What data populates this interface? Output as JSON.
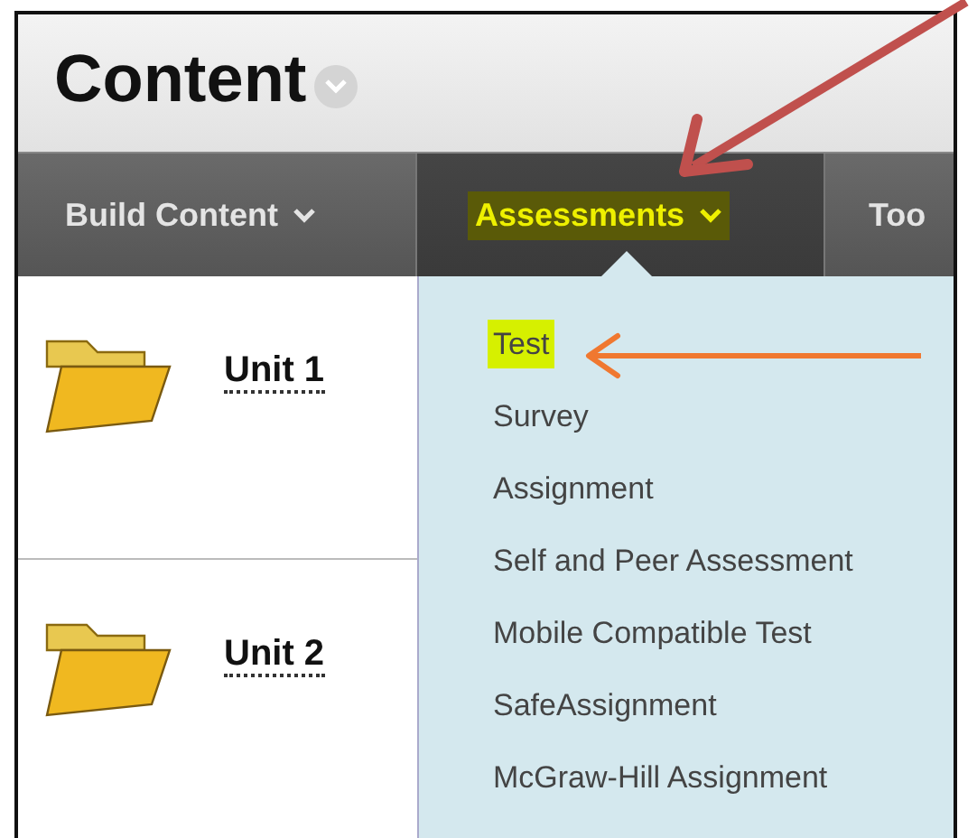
{
  "page": {
    "title": "Content"
  },
  "tabs": [
    {
      "label": "Build Content",
      "selected": false,
      "highlighted": false,
      "caret": true
    },
    {
      "label": "Assessments",
      "selected": true,
      "highlighted": true,
      "caret": true
    },
    {
      "label": "Too",
      "selected": false,
      "highlighted": false,
      "caret": false
    }
  ],
  "items": [
    {
      "title": "Unit 1"
    },
    {
      "title": "Unit 2"
    }
  ],
  "menu": {
    "items": [
      {
        "label": "Test",
        "highlighted": true
      },
      {
        "label": "Survey",
        "highlighted": false
      },
      {
        "label": "Assignment",
        "highlighted": false
      },
      {
        "label": "Self and Peer Assessment",
        "highlighted": false
      },
      {
        "label": "Mobile Compatible Test",
        "highlighted": false
      },
      {
        "label": "SafeAssignment",
        "highlighted": false
      },
      {
        "label": "McGraw-Hill Assignment",
        "highlighted": false
      }
    ]
  },
  "annotations": [
    {
      "kind": "arrow",
      "color": "#c0504d"
    },
    {
      "kind": "arrow",
      "color": "#f07830"
    }
  ]
}
